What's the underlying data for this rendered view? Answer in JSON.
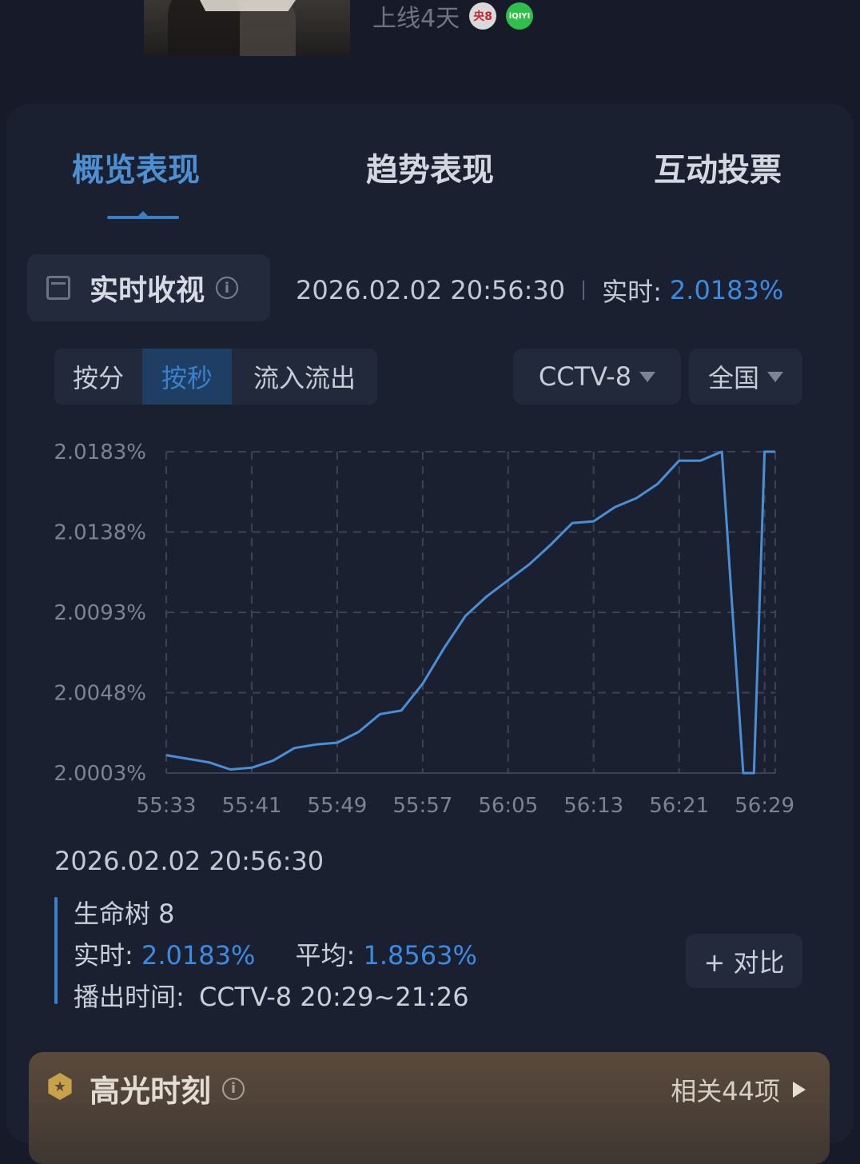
{
  "header": {
    "online_text": "上线4天",
    "badge_cctv": "央8",
    "badge_iqiyi": "iQIYI"
  },
  "tabs": [
    {
      "label": "概览表现",
      "active": true
    },
    {
      "label": "趋势表现",
      "active": false
    },
    {
      "label": "互动投票",
      "active": false
    }
  ],
  "realtime": {
    "title": "实时收视",
    "datetime": "2026.02.02 20:56:30",
    "label": "实时:",
    "value": "2.0183%"
  },
  "segments": [
    "按分",
    "按秒",
    "流入流出"
  ],
  "selected_segment": "按秒",
  "filters": {
    "channel": "CCTV-8",
    "region": "全国"
  },
  "chart_data": {
    "type": "line",
    "x": [
      "55:33",
      "55:35",
      "55:37",
      "55:39",
      "55:41",
      "55:43",
      "55:45",
      "55:47",
      "55:49",
      "55:51",
      "55:53",
      "55:55",
      "55:57",
      "55:59",
      "56:01",
      "56:03",
      "56:05",
      "56:07",
      "56:09",
      "56:11",
      "56:13",
      "56:15",
      "56:17",
      "56:19",
      "56:21",
      "56:23",
      "56:25",
      "56:27",
      "56:28",
      "56:29",
      "56:30"
    ],
    "xticks": [
      "55:33",
      "55:41",
      "55:49",
      "55:57",
      "56:05",
      "56:13",
      "56:21",
      "56:29"
    ],
    "yticks": [
      "2.0183%",
      "2.0138%",
      "2.0093%",
      "2.0048%",
      "2.0003%"
    ],
    "ylim": [
      2.0003,
      2.0183
    ],
    "series": [
      {
        "values": [
          2.0013,
          2.0011,
          2.0009,
          2.0005,
          2.0006,
          2.001,
          2.0017,
          2.0019,
          2.002,
          2.0026,
          2.0036,
          2.0038,
          2.0053,
          2.0073,
          2.0091,
          2.0102,
          2.0111,
          2.012,
          2.0131,
          2.0143,
          2.0144,
          2.0152,
          2.0157,
          2.0165,
          2.0178,
          2.0178,
          2.0183,
          2.0003,
          2.0003,
          2.0183,
          2.0183
        ],
        "color": "#4a8fd6"
      }
    ],
    "grid": true,
    "grid_style": "dashed"
  },
  "detail": {
    "datetime": "2026.02.02 20:56:30",
    "program": "生命树 8",
    "realtime_label": "实时:",
    "realtime_value": "2.0183%",
    "avg_label": "平均:",
    "avg_value": "1.8563%",
    "airtime_label": "播出时间:",
    "airtime_value": "CCTV-8 20:29~21:26",
    "compare_label": "+ 对比"
  },
  "highlight": {
    "title": "高光时刻",
    "count_text": "相关44项"
  },
  "colors": {
    "accent": "#3d8be0",
    "background": "#161a29",
    "card": "#1b2031"
  }
}
